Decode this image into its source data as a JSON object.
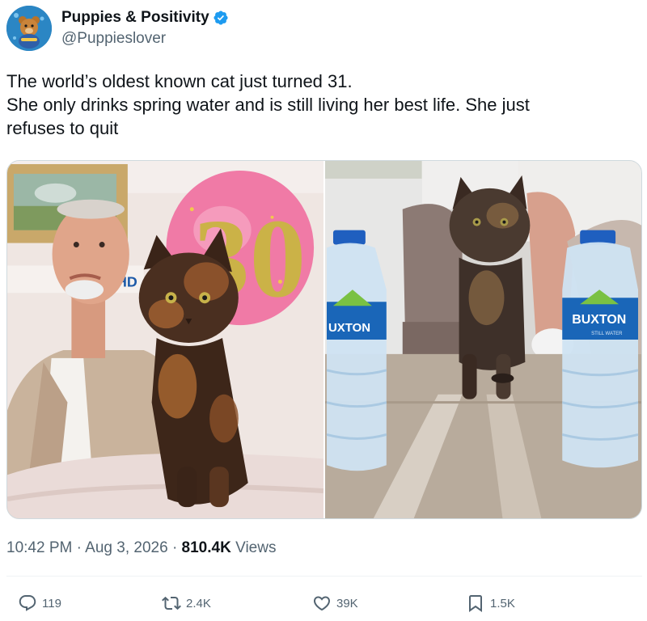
{
  "account": {
    "display_name": "Puppies & Positivity",
    "handle": "@Puppieslover",
    "verified": true,
    "avatar_icon": "bear-mascot-icon"
  },
  "tweet": {
    "lines": [
      "The world’s oldest known cat just turned 31.",
      "She only drinks spring water and is still living her best life. She just",
      "refuses to quit"
    ]
  },
  "media": {
    "left_photo": {
      "balloon_text": "30",
      "sign_text": "HD"
    },
    "right_photo": {
      "bottle_label_left": "UXTON",
      "bottle_label_right": "BUXTON",
      "bottle_sublabel": "STILL WATER"
    }
  },
  "meta": {
    "time": "10:42 PM",
    "separator": "·",
    "date": "Aug 3, 2026",
    "views_count": "810.4K",
    "views_label": "Views"
  },
  "actions": {
    "reply_count": "119",
    "retweet_count": "2.4K",
    "like_count": "39K",
    "bookmark_count": "1.5K"
  },
  "colors": {
    "text": "#0f1419",
    "secondary": "#536471",
    "verified": "#1d9bf0",
    "border": "#cfd9de"
  }
}
